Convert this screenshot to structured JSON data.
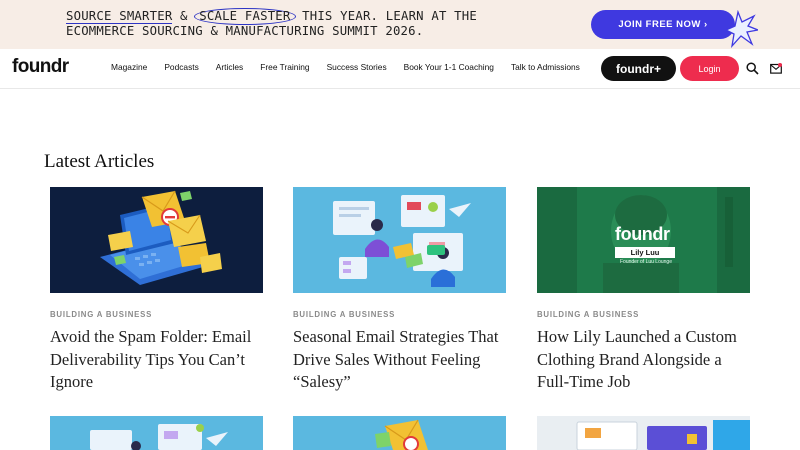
{
  "banner": {
    "part1": "SOURCE SMARTER",
    "amp": " & ",
    "part2": "SCALE FASTER",
    "part3": " THIS YEAR. LEARN AT THE",
    "line2": "ECOMMERCE SOURCING & MANUFACTURING SUMMIT 2026.",
    "cta": "JOIN FREE NOW ›"
  },
  "nav": {
    "logo": "foundr",
    "links": [
      "Magazine",
      "Podcasts",
      "Articles",
      "Free Training",
      "Success Stories",
      "Book Your 1-1 Coaching",
      "Talk to Admissions"
    ],
    "foundr_plus": "foundr+",
    "login": "Login"
  },
  "main": {
    "section_title": "Latest Articles",
    "articles": [
      {
        "category": "BUILDING A BUSINESS",
        "title": "Avoid the Spam Folder: Email Deliverability Tips You Can’t Ignore"
      },
      {
        "category": "BUILDING A BUSINESS",
        "title": "Seasonal Email Strategies That Drive Sales Without Feeling “Salesy”"
      },
      {
        "category": "BUILDING A BUSINESS",
        "title": "How Lily Launched a Custom Clothing Brand Alongside a Full-Time Job"
      }
    ],
    "thumb_overlay": {
      "logo": "foundr",
      "name": "Lily Luu",
      "role": "Founder of Luu Lounge"
    }
  },
  "colors": {
    "banner_bg": "#f7ede6",
    "cta_blue": "#3f39e0",
    "login_red": "#ee2c4e",
    "accent_circle": "#2d34c4"
  }
}
